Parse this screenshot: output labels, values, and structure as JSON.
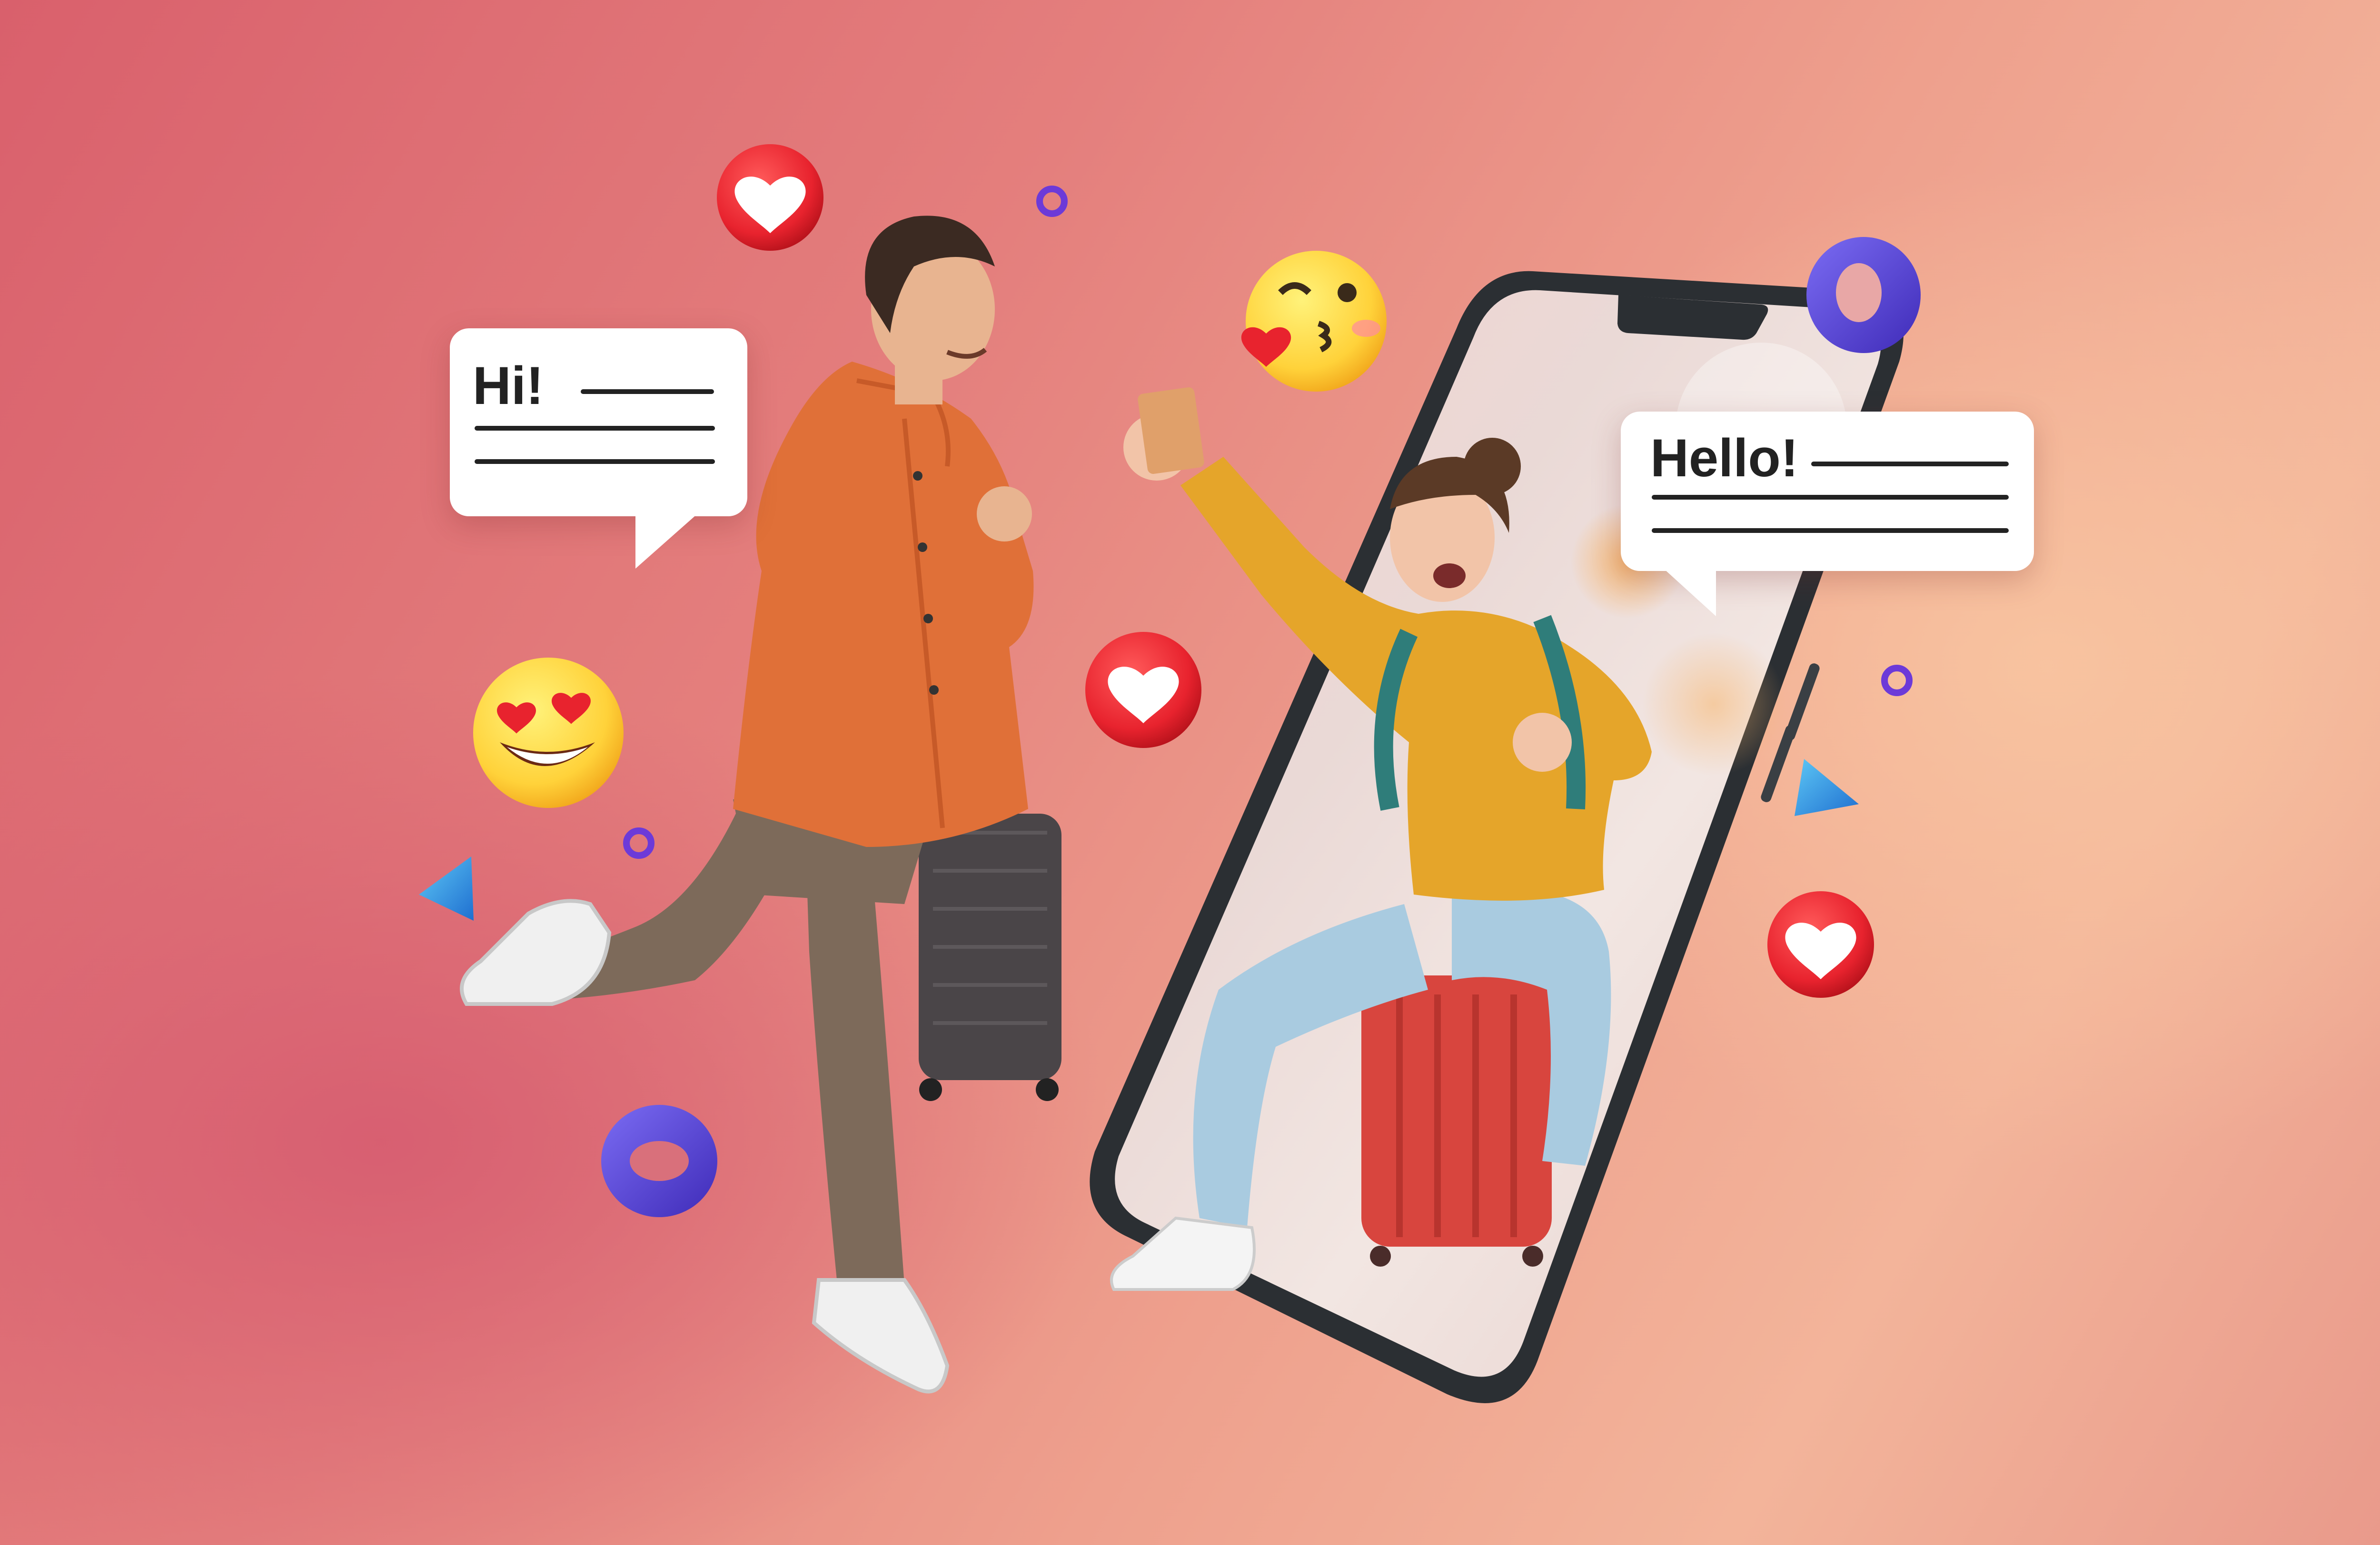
{
  "bubbles": {
    "left": {
      "greeting": "Hi!"
    },
    "right": {
      "greeting": "Hello!"
    }
  },
  "icons": [
    "heart-icon",
    "heart-eyes-emoji-icon",
    "kiss-emoji-icon",
    "ring-icon",
    "triangle-icon"
  ],
  "colors": {
    "background_left": "#d9606c",
    "background_right": "#f3b49a",
    "heart_red": "#e8232e",
    "emoji_yellow": "#ffd23a",
    "ring_purple": "#5b3fd8",
    "triangle_blue": "#2f8fe0",
    "phone_frame": "#2b2f33",
    "jacket_orange": "#e07038",
    "hoodie_yellow": "#e5a52a",
    "suitcase_red": "#d8453e"
  }
}
